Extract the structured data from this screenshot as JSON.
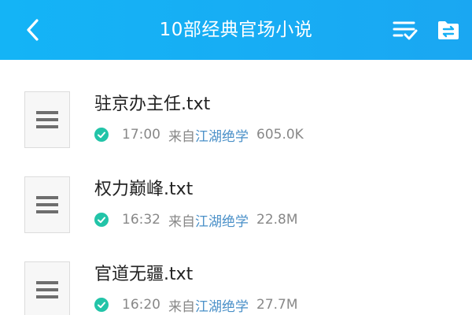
{
  "header": {
    "title": "10部经典官场小说",
    "back_icon": "chevron-left-icon",
    "select_icon": "list-check-icon",
    "folder_icon": "folder-transfer-icon",
    "color": "#16b0f5"
  },
  "files": [
    {
      "name": "驻京办主任.txt",
      "time": "17:00",
      "source_prefix": "来自",
      "source": "江湖绝学",
      "size": "605.0K"
    },
    {
      "name": "权力巅峰.txt",
      "time": "16:32",
      "source_prefix": "来自",
      "source": "江湖绝学",
      "size": "22.8M"
    },
    {
      "name": "官道无疆.txt",
      "time": "16:20",
      "source_prefix": "来自",
      "source": "江湖绝学",
      "size": "27.7M"
    }
  ],
  "status_color": "#22c4a8",
  "link_color": "#4a90c8"
}
